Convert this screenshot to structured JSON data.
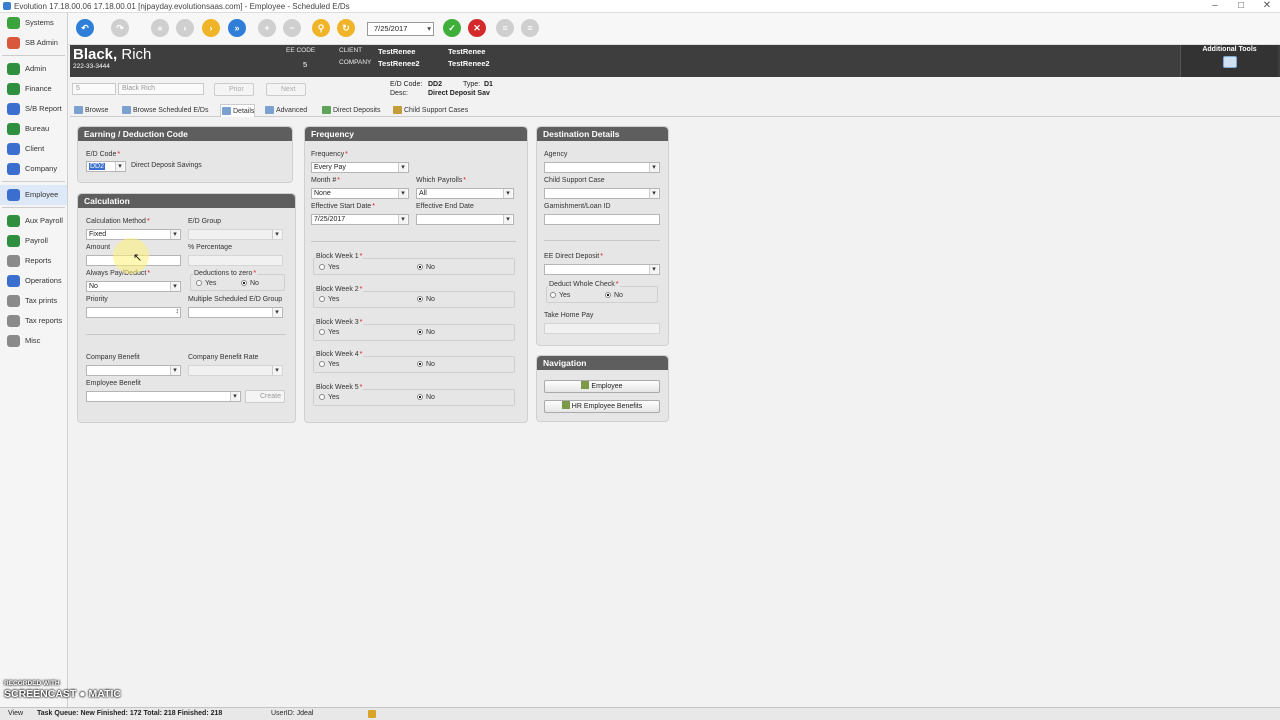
{
  "window": {
    "title": "Evolution 17.18.00.06  17.18.00.01 [njpayday.evolutionsaas.com] - Employee - Scheduled E/Ds"
  },
  "sidebar": {
    "items": [
      {
        "label": "Systems",
        "color": "#3aa43a"
      },
      {
        "label": "SB Admin",
        "color": "#d9573a"
      },
      {
        "label": "Admin",
        "color": "#2f8f3f"
      },
      {
        "label": "Finance",
        "color": "#2f8f3f"
      },
      {
        "label": "S/B Report",
        "color": "#3a6fd0"
      },
      {
        "label": "Bureau",
        "color": "#2f8f3f"
      },
      {
        "label": "Client",
        "color": "#3a6fd0"
      },
      {
        "label": "Company",
        "color": "#3a6fd0"
      },
      {
        "label": "Employee",
        "color": "#3a6fd0"
      },
      {
        "label": "Aux Payroll",
        "color": "#2f8f3f"
      },
      {
        "label": "Payroll",
        "color": "#2f8f3f"
      },
      {
        "label": "Reports",
        "color": "#8a8a8a"
      },
      {
        "label": "Operations",
        "color": "#3a6fd0"
      },
      {
        "label": "Tax prints",
        "color": "#8a8a8a"
      },
      {
        "label": "Tax reports",
        "color": "#8a8a8a"
      },
      {
        "label": "Misc",
        "color": "#8a8a8a"
      }
    ]
  },
  "toolbar": {
    "date": "7/25/2017"
  },
  "header": {
    "last_name": "Black,",
    "first_name": "Rich",
    "ssn": "222-33-3444",
    "ee_code_label": "EE CODE",
    "ee_code": "5",
    "client_label": "CLIENT",
    "company_label": "COMPANY",
    "client_name": "TestRenee",
    "company_name": "TestRenee2",
    "client_code": "TestRenee",
    "company_code": "TestRenee2",
    "additional_tools": "Additional Tools"
  },
  "subbar": {
    "ee_select": "5",
    "name_select": "Black Rich",
    "prior": "Prior",
    "next": "Next",
    "ed_code_label": "E/D Code:",
    "ed_code": "DD2",
    "type_label": "Type:",
    "type": "D1",
    "desc_label": "Desc:",
    "desc": "Direct Deposit Sav"
  },
  "tabs": [
    "Browse",
    "Browse Scheduled E/Ds",
    "Details",
    "Advanced",
    "Direct Deposits",
    "Child Support Cases"
  ],
  "earning": {
    "title": "Earning / Deduction Code",
    "ed_code_label": "E/D Code",
    "ed_code": "DD2",
    "ed_desc": "Direct Deposit Savings"
  },
  "calc": {
    "title": "Calculation",
    "method_label": "Calculation Method",
    "method": "Fixed",
    "group_label": "E/D Group",
    "amount_label": "Amount",
    "percentage_label": "% Percentage",
    "always_pay_label": "Always Pay/Deduct",
    "always_pay": "No",
    "deductions_zero_label": "Deductions to zero",
    "yes": "Yes",
    "no": "No",
    "priority_label": "Priority",
    "multiple_group_label": "Multiple Scheduled E/D Group",
    "company_benefit_label": "Company Benefit",
    "company_benefit_rate_label": "Company Benefit Rate",
    "employee_benefit_label": "Employee Benefit",
    "create": "Create"
  },
  "frequency": {
    "title": "Frequency",
    "frequency_label": "Frequency",
    "frequency": "Every Pay",
    "month_label": "Month #",
    "month": "None",
    "which_payrolls_label": "Which Payrolls",
    "which_payrolls": "All",
    "start_label": "Effective Start Date",
    "start": "7/25/2017",
    "end_label": "Effective End Date",
    "blocks": [
      "Block Week 1",
      "Block Week 2",
      "Block Week 3",
      "Block Week 4",
      "Block Week 5"
    ],
    "yes": "Yes",
    "no": "No"
  },
  "destination": {
    "title": "Destination Details",
    "agency_label": "Agency",
    "child_support_label": "Child Support Case",
    "garnishment_label": "Garnishment/Loan ID",
    "ee_dd_label": "EE Direct Deposit",
    "whole_check_label": "Deduct Whole Check",
    "yes": "Yes",
    "no": "No",
    "take_home_label": "Take Home Pay"
  },
  "navigation": {
    "title": "Navigation",
    "employee": "Employee",
    "hr_benefits": "HR Employee Benefits"
  },
  "status": {
    "view": "View",
    "queue": "Task Queue:  New Finished: 172  Total: 218  Finished: 218",
    "user": "UserID: Jdeal"
  },
  "watermark": {
    "line1": "RECORDED WITH",
    "line2": "SCREENCAST ● MATIC"
  }
}
